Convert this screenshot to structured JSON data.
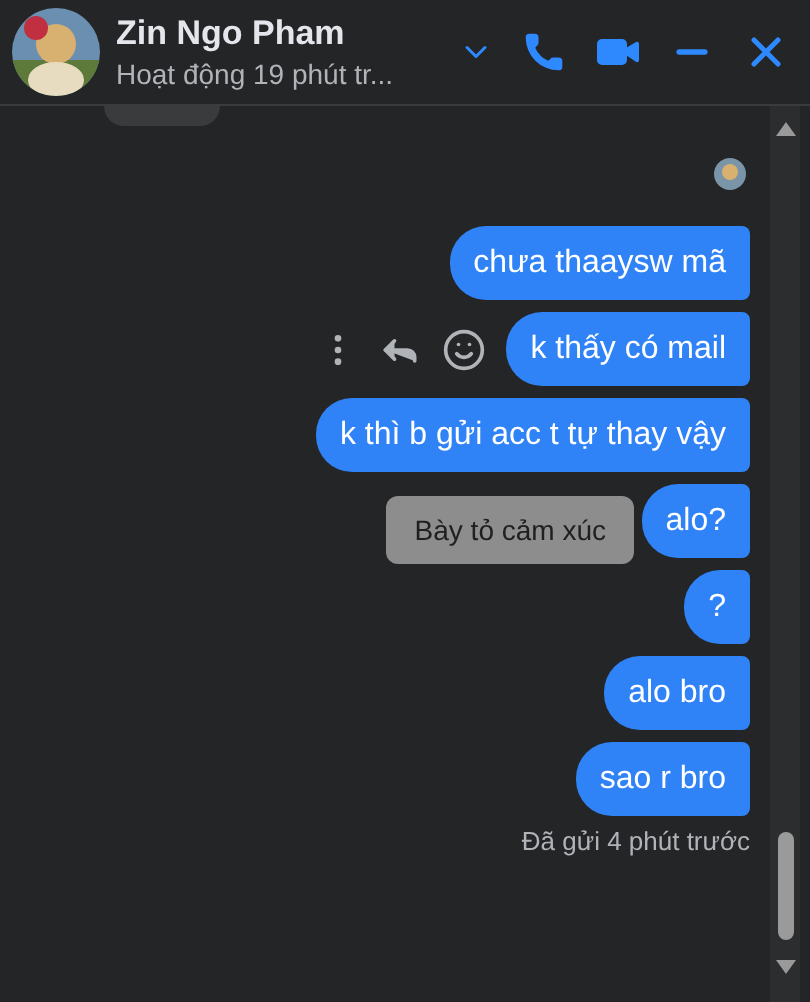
{
  "header": {
    "name": "Zin Ngo Pham",
    "status": "Hoạt động 19 phút tr..."
  },
  "messages": [
    {
      "text": "chưa thaaysw mã"
    },
    {
      "text": "k thấy có mail",
      "actions": true
    },
    {
      "text": "k thì b gửi acc t tự thay vậy"
    },
    {
      "text": "alo?",
      "tooltip": "Bày tỏ cảm xúc"
    },
    {
      "text": "?"
    },
    {
      "text": "alo bro"
    },
    {
      "text": "sao r bro"
    }
  ],
  "receipt": "Đã gửi 4 phút trước"
}
